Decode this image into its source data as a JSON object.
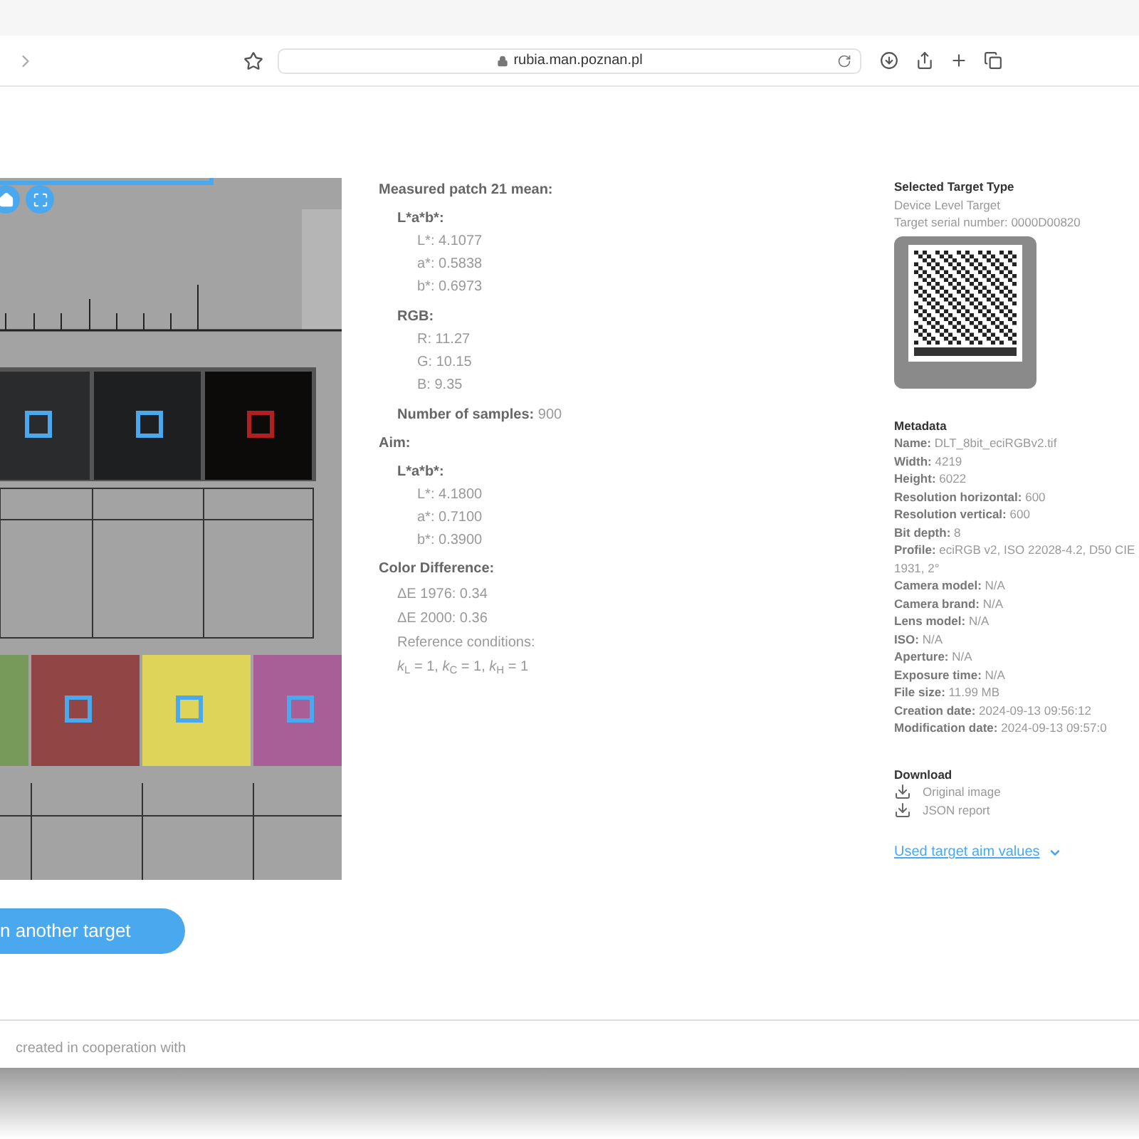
{
  "browser": {
    "url": "rubia.man.poznan.pl"
  },
  "measured": {
    "title": "Measured patch 21 mean:",
    "groups": [
      {
        "title": "L*a*b*:",
        "items": [
          "L*: 4.1077",
          "a*: 0.5838",
          "b*: 0.6973"
        ]
      },
      {
        "title": "RGB:",
        "items": [
          "R: 11.27",
          "G: 10.15",
          "B: 9.35"
        ]
      }
    ],
    "samples": {
      "label": "Number of samples:",
      "value": "900"
    }
  },
  "aim": {
    "title": "Aim:",
    "groups": [
      {
        "title": "L*a*b*:",
        "items": [
          "L*: 4.1800",
          "a*: 0.7100",
          "b*: 0.3900"
        ]
      }
    ]
  },
  "color_difference": {
    "title": "Color Difference:",
    "items": [
      "ΔE 1976: 0.34",
      "ΔE 2000: 0.36",
      "Reference conditions:"
    ],
    "formula": "*k*$_{L}$ = 1, *k*$_{C}$ = 1, *k*$_{H}$ = 1"
  },
  "target": {
    "title": "Selected Target Type",
    "type": "Device Level Target",
    "serial": "Target serial number: 0000D00820"
  },
  "metadata": {
    "title": "Metadata",
    "rows": [
      {
        "label": "Name:",
        "value": "DLT_8bit_eciRGBv2.tif"
      },
      {
        "label": "Width:",
        "value": "4219"
      },
      {
        "label": "Height:",
        "value": "6022"
      },
      {
        "label": "Resolution horizontal:",
        "value": "600"
      },
      {
        "label": "Resolution vertical:",
        "value": "600"
      },
      {
        "label": "Bit depth:",
        "value": "8"
      },
      {
        "label": "Profile:",
        "value": "eciRGB v2, ISO 22028-4.2, D50 CIE 1931, 2°"
      },
      {
        "label": "Camera model:",
        "value": "N/A"
      },
      {
        "label": "Camera brand:",
        "value": "N/A"
      },
      {
        "label": "Lens model:",
        "value": "N/A"
      },
      {
        "label": "ISO:",
        "value": "N/A"
      },
      {
        "label": "Aperture:",
        "value": "N/A"
      },
      {
        "label": "Exposure time:",
        "value": "N/A"
      },
      {
        "label": "File size:",
        "value": "11.99 MB"
      },
      {
        "label": "Creation date:",
        "value": "2024-09-13 09:56:12"
      },
      {
        "label": "Modification date:",
        "value": "2024-09-13 09:57:0"
      }
    ]
  },
  "download": {
    "title": "Download",
    "items": [
      "Original image",
      "JSON report"
    ]
  },
  "aim_values_link": "Used target aim values",
  "scan_button": "n another target",
  "footer": {
    "text": "created in cooperation with"
  }
}
